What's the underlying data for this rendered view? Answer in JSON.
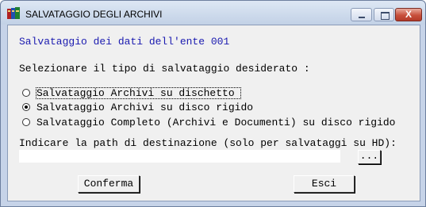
{
  "window": {
    "title": "SALVATAGGIO DEGLI ARCHIVI",
    "close_glyph": "X",
    "icon": "archive-app-icon"
  },
  "form": {
    "heading": "Salvataggio dei dati dell'ente 001",
    "prompt": "Selezionare il tipo di salvataggio desiderato :",
    "options": [
      {
        "label": "Salvataggio Archivi su dischetto",
        "selected": false,
        "focused": true
      },
      {
        "label": "Salvataggio Archivi su disco rigido",
        "selected": true,
        "focused": false
      },
      {
        "label": "Salvataggio Completo (Archivi e Documenti) su disco rigido",
        "selected": false,
        "focused": false
      }
    ],
    "path_label": "Indicare la path di destinazione (solo per salvataggi su HD):",
    "path_value": "",
    "browse_label": "...",
    "confirm_label": "Conferma",
    "exit_label": "Esci"
  },
  "colors": {
    "heading": "#1a1ab0",
    "dialog_bg": "#f0f0f0",
    "frame": "#c6d3e8"
  }
}
